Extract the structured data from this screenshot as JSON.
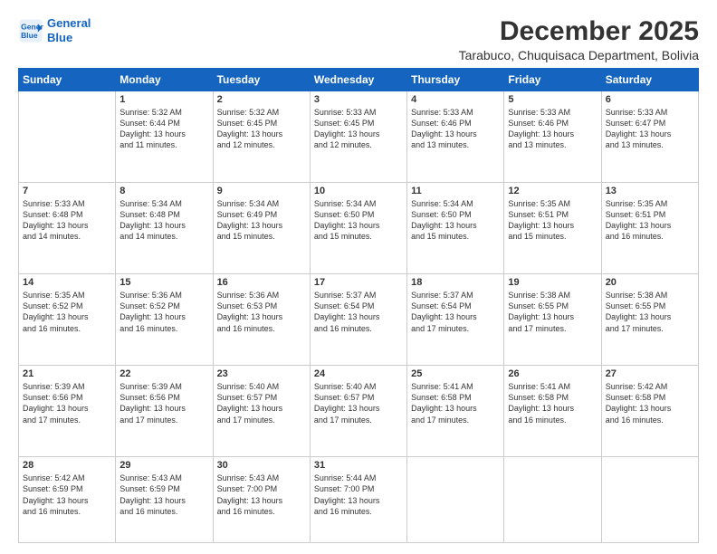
{
  "logo": {
    "line1": "General",
    "line2": "Blue"
  },
  "title": "December 2025",
  "subtitle": "Tarabuco, Chuquisaca Department, Bolivia",
  "headers": [
    "Sunday",
    "Monday",
    "Tuesday",
    "Wednesday",
    "Thursday",
    "Friday",
    "Saturday"
  ],
  "weeks": [
    [
      {
        "day": "",
        "text": ""
      },
      {
        "day": "1",
        "text": "Sunrise: 5:32 AM\nSunset: 6:44 PM\nDaylight: 13 hours\nand 11 minutes."
      },
      {
        "day": "2",
        "text": "Sunrise: 5:32 AM\nSunset: 6:45 PM\nDaylight: 13 hours\nand 12 minutes."
      },
      {
        "day": "3",
        "text": "Sunrise: 5:33 AM\nSunset: 6:45 PM\nDaylight: 13 hours\nand 12 minutes."
      },
      {
        "day": "4",
        "text": "Sunrise: 5:33 AM\nSunset: 6:46 PM\nDaylight: 13 hours\nand 13 minutes."
      },
      {
        "day": "5",
        "text": "Sunrise: 5:33 AM\nSunset: 6:46 PM\nDaylight: 13 hours\nand 13 minutes."
      },
      {
        "day": "6",
        "text": "Sunrise: 5:33 AM\nSunset: 6:47 PM\nDaylight: 13 hours\nand 13 minutes."
      }
    ],
    [
      {
        "day": "7",
        "text": "Sunrise: 5:33 AM\nSunset: 6:48 PM\nDaylight: 13 hours\nand 14 minutes."
      },
      {
        "day": "8",
        "text": "Sunrise: 5:34 AM\nSunset: 6:48 PM\nDaylight: 13 hours\nand 14 minutes."
      },
      {
        "day": "9",
        "text": "Sunrise: 5:34 AM\nSunset: 6:49 PM\nDaylight: 13 hours\nand 15 minutes."
      },
      {
        "day": "10",
        "text": "Sunrise: 5:34 AM\nSunset: 6:50 PM\nDaylight: 13 hours\nand 15 minutes."
      },
      {
        "day": "11",
        "text": "Sunrise: 5:34 AM\nSunset: 6:50 PM\nDaylight: 13 hours\nand 15 minutes."
      },
      {
        "day": "12",
        "text": "Sunrise: 5:35 AM\nSunset: 6:51 PM\nDaylight: 13 hours\nand 15 minutes."
      },
      {
        "day": "13",
        "text": "Sunrise: 5:35 AM\nSunset: 6:51 PM\nDaylight: 13 hours\nand 16 minutes."
      }
    ],
    [
      {
        "day": "14",
        "text": "Sunrise: 5:35 AM\nSunset: 6:52 PM\nDaylight: 13 hours\nand 16 minutes."
      },
      {
        "day": "15",
        "text": "Sunrise: 5:36 AM\nSunset: 6:52 PM\nDaylight: 13 hours\nand 16 minutes."
      },
      {
        "day": "16",
        "text": "Sunrise: 5:36 AM\nSunset: 6:53 PM\nDaylight: 13 hours\nand 16 minutes."
      },
      {
        "day": "17",
        "text": "Sunrise: 5:37 AM\nSunset: 6:54 PM\nDaylight: 13 hours\nand 16 minutes."
      },
      {
        "day": "18",
        "text": "Sunrise: 5:37 AM\nSunset: 6:54 PM\nDaylight: 13 hours\nand 17 minutes."
      },
      {
        "day": "19",
        "text": "Sunrise: 5:38 AM\nSunset: 6:55 PM\nDaylight: 13 hours\nand 17 minutes."
      },
      {
        "day": "20",
        "text": "Sunrise: 5:38 AM\nSunset: 6:55 PM\nDaylight: 13 hours\nand 17 minutes."
      }
    ],
    [
      {
        "day": "21",
        "text": "Sunrise: 5:39 AM\nSunset: 6:56 PM\nDaylight: 13 hours\nand 17 minutes."
      },
      {
        "day": "22",
        "text": "Sunrise: 5:39 AM\nSunset: 6:56 PM\nDaylight: 13 hours\nand 17 minutes."
      },
      {
        "day": "23",
        "text": "Sunrise: 5:40 AM\nSunset: 6:57 PM\nDaylight: 13 hours\nand 17 minutes."
      },
      {
        "day": "24",
        "text": "Sunrise: 5:40 AM\nSunset: 6:57 PM\nDaylight: 13 hours\nand 17 minutes."
      },
      {
        "day": "25",
        "text": "Sunrise: 5:41 AM\nSunset: 6:58 PM\nDaylight: 13 hours\nand 17 minutes."
      },
      {
        "day": "26",
        "text": "Sunrise: 5:41 AM\nSunset: 6:58 PM\nDaylight: 13 hours\nand 16 minutes."
      },
      {
        "day": "27",
        "text": "Sunrise: 5:42 AM\nSunset: 6:58 PM\nDaylight: 13 hours\nand 16 minutes."
      }
    ],
    [
      {
        "day": "28",
        "text": "Sunrise: 5:42 AM\nSunset: 6:59 PM\nDaylight: 13 hours\nand 16 minutes."
      },
      {
        "day": "29",
        "text": "Sunrise: 5:43 AM\nSunset: 6:59 PM\nDaylight: 13 hours\nand 16 minutes."
      },
      {
        "day": "30",
        "text": "Sunrise: 5:43 AM\nSunset: 7:00 PM\nDaylight: 13 hours\nand 16 minutes."
      },
      {
        "day": "31",
        "text": "Sunrise: 5:44 AM\nSunset: 7:00 PM\nDaylight: 13 hours\nand 16 minutes."
      },
      {
        "day": "",
        "text": ""
      },
      {
        "day": "",
        "text": ""
      },
      {
        "day": "",
        "text": ""
      }
    ]
  ]
}
